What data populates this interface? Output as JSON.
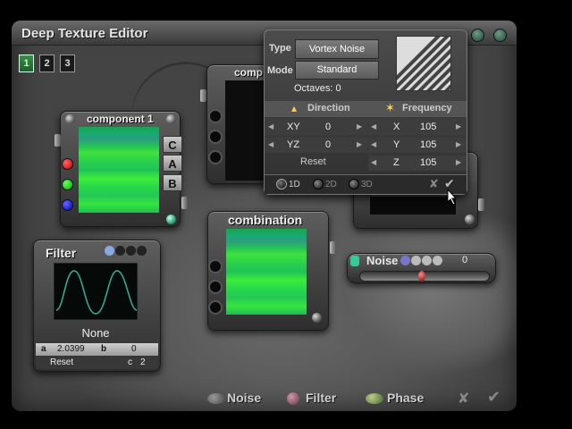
{
  "window": {
    "title": "Deep Texture Editor"
  },
  "tabs": [
    "1",
    "2",
    "3"
  ],
  "component1": {
    "title": "component 1",
    "buttons": [
      "C",
      "A",
      "B"
    ]
  },
  "component2": {
    "title": "comp"
  },
  "combination": {
    "title": "combination"
  },
  "filter": {
    "title": "Filter",
    "mode": "None",
    "a_label": "a",
    "a_value": "2.0399",
    "b_label": "b",
    "b_value": "0",
    "c_label": "c",
    "c_value": "2",
    "reset_label": "Reset"
  },
  "noise": {
    "label": "Noise",
    "value": "0"
  },
  "popup": {
    "type_label": "Type",
    "type_value": "Vortex Noise",
    "mode_label": "Mode",
    "mode_value": "Standard",
    "octaves_text": "Octaves: 0",
    "direction_label": "Direction",
    "frequency_label": "Frequency",
    "xy_label": "XY",
    "xy_value": "0",
    "yz_label": "YZ",
    "yz_value": "0",
    "reset_label": "Reset",
    "x_label": "X",
    "x_value": "105",
    "y_label": "Y",
    "y_value": "105",
    "z_label": "Z",
    "z_value": "105",
    "dim_1d": "1D",
    "dim_2d": "2D",
    "dim_3d": "3D",
    "cancel": "✘",
    "ok": "✔"
  },
  "bottom": {
    "noise": "Noise",
    "filter": "Filter",
    "phase": "Phase",
    "cancel": "✘",
    "ok": "✔"
  },
  "colors": {
    "input_red": "#e21d1d",
    "input_green": "#22e022",
    "input_blue": "#1d3fe8"
  }
}
